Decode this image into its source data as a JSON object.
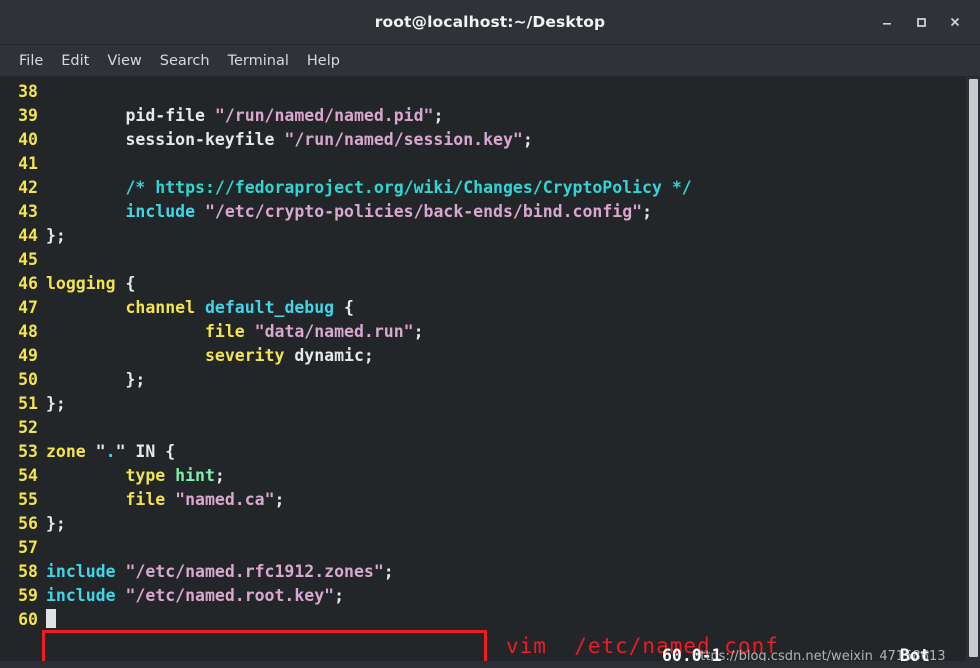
{
  "window": {
    "title": "root@localhost:~/Desktop",
    "controls": [
      {
        "name": "minimize",
        "label": "_"
      },
      {
        "name": "maximize",
        "label": "□"
      },
      {
        "name": "close",
        "label": "×"
      }
    ]
  },
  "menubar": {
    "items": [
      "File",
      "Edit",
      "View",
      "Search",
      "Terminal",
      "Help"
    ]
  },
  "editor": {
    "lines": [
      {
        "n": "38",
        "tokens": []
      },
      {
        "n": "39",
        "tokens": [
          {
            "t": "        pid-file ",
            "c": "plain"
          },
          {
            "t": "\"/run/named/named.pid\"",
            "c": "str"
          },
          {
            "t": ";",
            "c": "plain"
          }
        ]
      },
      {
        "n": "40",
        "tokens": [
          {
            "t": "        session-keyfile ",
            "c": "plain"
          },
          {
            "t": "\"/run/named/session.key\"",
            "c": "str"
          },
          {
            "t": ";",
            "c": "plain"
          }
        ]
      },
      {
        "n": "41",
        "tokens": []
      },
      {
        "n": "42",
        "tokens": [
          {
            "t": "        ",
            "c": "plain"
          },
          {
            "t": "/* https://fedoraproject.org/wiki/Changes/CryptoPolicy */",
            "c": "comment"
          }
        ]
      },
      {
        "n": "43",
        "tokens": [
          {
            "t": "        ",
            "c": "plain"
          },
          {
            "t": "include",
            "c": "ident"
          },
          {
            "t": " ",
            "c": "plain"
          },
          {
            "t": "\"/etc/crypto-policies/back-ends/bind.config\"",
            "c": "str"
          },
          {
            "t": ";",
            "c": "plain"
          }
        ]
      },
      {
        "n": "44",
        "tokens": [
          {
            "t": "};",
            "c": "plain"
          }
        ]
      },
      {
        "n": "45",
        "tokens": []
      },
      {
        "n": "46",
        "tokens": [
          {
            "t": "logging",
            "c": "kw"
          },
          {
            "t": " {",
            "c": "plain"
          }
        ]
      },
      {
        "n": "47",
        "tokens": [
          {
            "t": "        ",
            "c": "plain"
          },
          {
            "t": "channel",
            "c": "kw"
          },
          {
            "t": " ",
            "c": "plain"
          },
          {
            "t": "default_debug",
            "c": "ident"
          },
          {
            "t": " {",
            "c": "plain"
          }
        ]
      },
      {
        "n": "48",
        "tokens": [
          {
            "t": "                ",
            "c": "plain"
          },
          {
            "t": "file",
            "c": "kw"
          },
          {
            "t": " ",
            "c": "plain"
          },
          {
            "t": "\"data/named.run\"",
            "c": "str"
          },
          {
            "t": ";",
            "c": "plain"
          }
        ]
      },
      {
        "n": "49",
        "tokens": [
          {
            "t": "                ",
            "c": "plain"
          },
          {
            "t": "severity",
            "c": "kw"
          },
          {
            "t": " dynamic;",
            "c": "plain"
          }
        ]
      },
      {
        "n": "50",
        "tokens": [
          {
            "t": "        };",
            "c": "plain"
          }
        ]
      },
      {
        "n": "51",
        "tokens": [
          {
            "t": "};",
            "c": "plain"
          }
        ]
      },
      {
        "n": "52",
        "tokens": []
      },
      {
        "n": "53",
        "tokens": [
          {
            "t": "zone",
            "c": "kw"
          },
          {
            "t": " \"",
            "c": "plain"
          },
          {
            "t": ".",
            "c": "cyan"
          },
          {
            "t": "\" IN {",
            "c": "plain"
          }
        ]
      },
      {
        "n": "54",
        "tokens": [
          {
            "t": "        ",
            "c": "plain"
          },
          {
            "t": "type",
            "c": "kw"
          },
          {
            "t": " ",
            "c": "plain"
          },
          {
            "t": "hint",
            "c": "type"
          },
          {
            "t": ";",
            "c": "plain"
          }
        ]
      },
      {
        "n": "55",
        "tokens": [
          {
            "t": "        ",
            "c": "plain"
          },
          {
            "t": "file",
            "c": "kw"
          },
          {
            "t": " ",
            "c": "plain"
          },
          {
            "t": "\"named.ca\"",
            "c": "str"
          },
          {
            "t": ";",
            "c": "plain"
          }
        ]
      },
      {
        "n": "56",
        "tokens": [
          {
            "t": "};",
            "c": "plain"
          }
        ]
      },
      {
        "n": "57",
        "tokens": []
      },
      {
        "n": "58",
        "tokens": [
          {
            "t": "include",
            "c": "ident"
          },
          {
            "t": " ",
            "c": "plain"
          },
          {
            "t": "\"/etc/named.rfc1912.zones\"",
            "c": "str"
          },
          {
            "t": ";",
            "c": "plain"
          }
        ]
      },
      {
        "n": "59",
        "tokens": [
          {
            "t": "include",
            "c": "ident"
          },
          {
            "t": " ",
            "c": "plain"
          },
          {
            "t": "\"/etc/named.root.key\"",
            "c": "str"
          },
          {
            "t": ";",
            "c": "plain"
          }
        ]
      },
      {
        "n": "60",
        "tokens": [],
        "cursor": true
      }
    ]
  },
  "annotation": {
    "text": "vim  /etc/named.conf",
    "color": "#ee1c24"
  },
  "statusline": {
    "position": "60,0-1",
    "state": "Bot"
  },
  "watermark": {
    "text": "https://blog.csdn.net/weixin_47158613"
  }
}
